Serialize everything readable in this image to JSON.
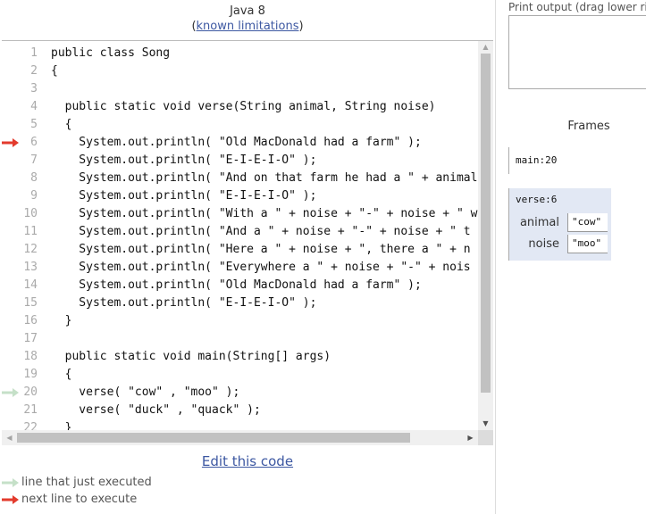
{
  "header": {
    "language": "Java 8",
    "limitations_open": "(",
    "limitations_link": "known limitations",
    "limitations_close": ")"
  },
  "code": {
    "lines": [
      {
        "num": "1",
        "text": "public class Song"
      },
      {
        "num": "2",
        "text": "{"
      },
      {
        "num": "3",
        "text": ""
      },
      {
        "num": "4",
        "text": "  public static void verse(String animal, String noise)"
      },
      {
        "num": "5",
        "text": "  {"
      },
      {
        "num": "6",
        "text": "    System.out.println( \"Old MacDonald had a farm\" );",
        "marker": "next"
      },
      {
        "num": "7",
        "text": "    System.out.println( \"E-I-E-I-O\" );"
      },
      {
        "num": "8",
        "text": "    System.out.println( \"And on that farm he had a \" + animal"
      },
      {
        "num": "9",
        "text": "    System.out.println( \"E-I-E-I-O\" );"
      },
      {
        "num": "10",
        "text": "    System.out.println( \"With a \" + noise + \"-\" + noise + \" w"
      },
      {
        "num": "11",
        "text": "    System.out.println( \"And a \" + noise + \"-\" + noise + \" t"
      },
      {
        "num": "12",
        "text": "    System.out.println( \"Here a \" + noise + \", there a \" + n"
      },
      {
        "num": "13",
        "text": "    System.out.println( \"Everywhere a \" + noise + \"-\" + nois"
      },
      {
        "num": "14",
        "text": "    System.out.println( \"Old MacDonald had a farm\" );"
      },
      {
        "num": "15",
        "text": "    System.out.println( \"E-I-E-I-O\" );"
      },
      {
        "num": "16",
        "text": "  }"
      },
      {
        "num": "17",
        "text": ""
      },
      {
        "num": "18",
        "text": "  public static void main(String[] args)"
      },
      {
        "num": "19",
        "text": "  {"
      },
      {
        "num": "20",
        "text": "    verse( \"cow\" , \"moo\" );",
        "marker": "just"
      },
      {
        "num": "21",
        "text": "    verse( \"duck\" , \"quack\" );"
      },
      {
        "num": "22",
        "text": "  }"
      }
    ]
  },
  "edit_link": "Edit this code",
  "legend": {
    "just_executed": "line that just executed",
    "next_to_execute": "next line to execute"
  },
  "colors": {
    "just_executed_arrow": "#c5e0c8",
    "next_arrow": "#e33b2d",
    "link": "#3d58a2",
    "frame_highlight": "#e2e8f4"
  },
  "output": {
    "label": "Print output (drag lower right corner to resize)",
    "content": ""
  },
  "frames": {
    "title": "Frames",
    "main": {
      "name": "main:20"
    },
    "verse": {
      "name": "verse:6",
      "vars": [
        {
          "name": "animal",
          "value": "\"cow\""
        },
        {
          "name": "noise",
          "value": "\"moo\""
        }
      ]
    }
  }
}
